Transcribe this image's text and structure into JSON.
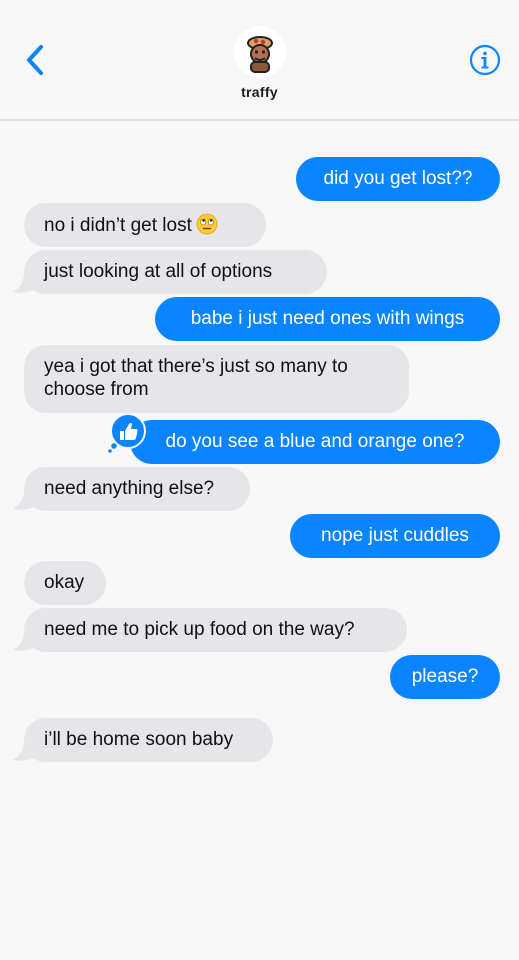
{
  "header": {
    "contact_name": "traffy",
    "back_icon": "chevron-left-icon",
    "info_icon": "info-circle-icon",
    "accent_color": "#0a84ff"
  },
  "messages": [
    {
      "direction": "sent",
      "text": "did you get lost??"
    },
    {
      "direction": "received",
      "text": "no i didn’t get lost",
      "emoji": "face-with-rolling-eyes"
    },
    {
      "direction": "received",
      "text": "just looking at all of options"
    },
    {
      "direction": "sent",
      "text": "babe i just need ones with wings"
    },
    {
      "direction": "received",
      "text": "yea i got that there’s just so many to choose from"
    },
    {
      "direction": "sent",
      "text": "do you see a blue and orange one?",
      "tapback": "thumbs-up-icon"
    },
    {
      "direction": "received",
      "text": "need anything else?"
    },
    {
      "direction": "sent",
      "text": "nope just cuddles"
    },
    {
      "direction": "received",
      "text": "okay"
    },
    {
      "direction": "received",
      "text": "need me to pick up food on the way?"
    },
    {
      "direction": "sent",
      "text": "please?"
    },
    {
      "direction": "received",
      "text": "i’ll be home soon baby"
    }
  ],
  "colors": {
    "sent_bubble": "#0a84ff",
    "received_bubble": "#e5e5ea",
    "background": "#f7f7f7"
  }
}
